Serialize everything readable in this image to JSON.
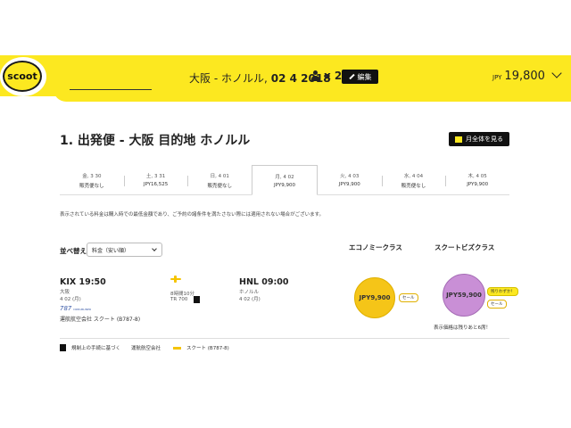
{
  "header": {
    "logo": "scoot",
    "route": "大阪 - ホノルル,",
    "date": "02 4 2018",
    "pax": "x 2",
    "edit_label": "編集",
    "price_currency": "JPY",
    "price_amount": "19,800"
  },
  "section": {
    "title": "1. 出発便 - 大阪 目的地 ホノルル",
    "month_button": "月全体を見る"
  },
  "date_strip": [
    {
      "date": "金, 3 30",
      "price": "販売便なし"
    },
    {
      "date": "土, 3 31",
      "price": "JPY16,525"
    },
    {
      "date": "日, 4 01",
      "price": "販売便なし"
    },
    {
      "date": "月, 4 02",
      "price": "JPY9,900"
    },
    {
      "date": "火, 4 03",
      "price": "JPY9,900"
    },
    {
      "date": "水, 4 04",
      "price": "販売便なし"
    },
    {
      "date": "木, 4 05",
      "price": "JPY9,900"
    }
  ],
  "note": "表示されている料金は購入時での最低金額であり、ご予約の諸条件を満たさない際には適用されない場合がございます。",
  "sort": {
    "label": "並べ替え",
    "value": "料金（安い順）"
  },
  "classes": {
    "economy": "エコノミークラス",
    "business": "スクートビズクラス"
  },
  "flight": {
    "dep_time": "KIX 19:50",
    "dep_city": "大阪",
    "dep_date": "4 02 (月)",
    "aircraft_logo": "787",
    "aircraft_logo_sub": "DREAMLINER",
    "airline": "運航航空会社 スクート",
    "aircraft": "(B787-8)",
    "duration": "8時間10分",
    "flight_no": "TR 700",
    "arr_time": "HNL 09:00",
    "arr_city": "ホノルル",
    "arr_date": "4 02 (月)",
    "eco_price": "JPY9,900",
    "eco_tag": "セール",
    "biz_price": "JPY59,900",
    "biz_tag1": "残りわずか！",
    "biz_tag2": "セール",
    "remaining": "表示価格は残りあと6席！"
  },
  "legend": {
    "item1": "規制上の手続に基づく",
    "item2": "運航航空会社",
    "item3": "スクート (B787-8)"
  }
}
